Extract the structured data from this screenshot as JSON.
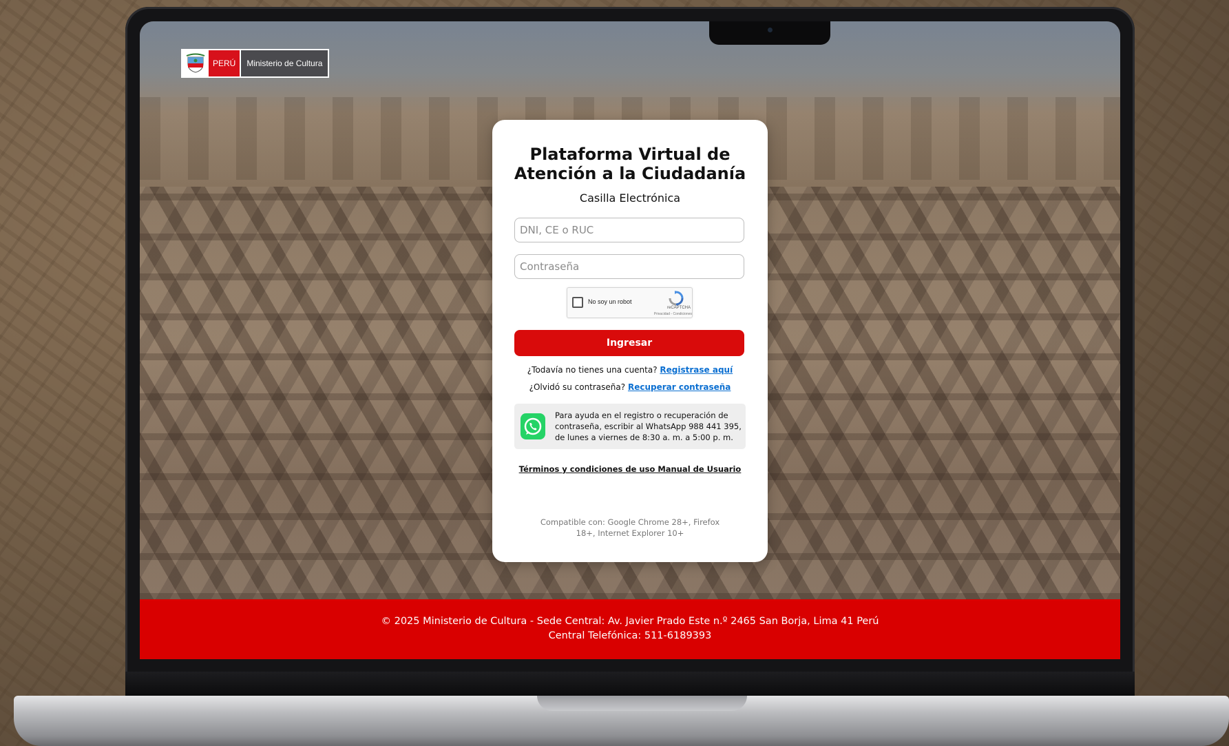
{
  "logo": {
    "country": "PERÚ",
    "ministry": "Ministerio de Cultura"
  },
  "login": {
    "title_line1": "Plataforma Virtual de",
    "title_line2": "Atención a la Ciudadanía",
    "subtitle": "Casilla Electrónica",
    "username_placeholder": "DNI, CE o RUC",
    "password_placeholder": "Contraseña",
    "captcha": {
      "label": "No soy un robot",
      "brand": "reCAPTCHA",
      "links": "Privacidad - Condiciones"
    },
    "submit_label": "Ingresar",
    "register_prompt": "¿Todavía no tienes una cuenta?",
    "register_link": "Registrase aquí",
    "forgot_prompt": "¿Olvidó su contraseña?",
    "forgot_link": "Recuperar contraseña",
    "help_text": "Para ayuda en el registro o recuperación de contraseña, escribir al WhatsApp 988 441 395, de lunes a viernes de 8:30 a. m. a 5:00 p. m.",
    "terms_link": "Términos y condiciones de uso Manual de Usuario",
    "compat_text": "Compatible con: Google Chrome 28+, Firefox 18+, Internet Explorer 10+"
  },
  "footer": {
    "line1": "© 2025 Ministerio de Cultura - Sede Central: Av. Javier Prado Este n.º 2465 San Borja, Lima 41 Perú",
    "line2": "Central Telefónica: 511-6189393"
  },
  "colors": {
    "primary_red": "#d90b0b",
    "link_blue": "#0b6fd1",
    "whatsapp_green": "#25d366"
  }
}
